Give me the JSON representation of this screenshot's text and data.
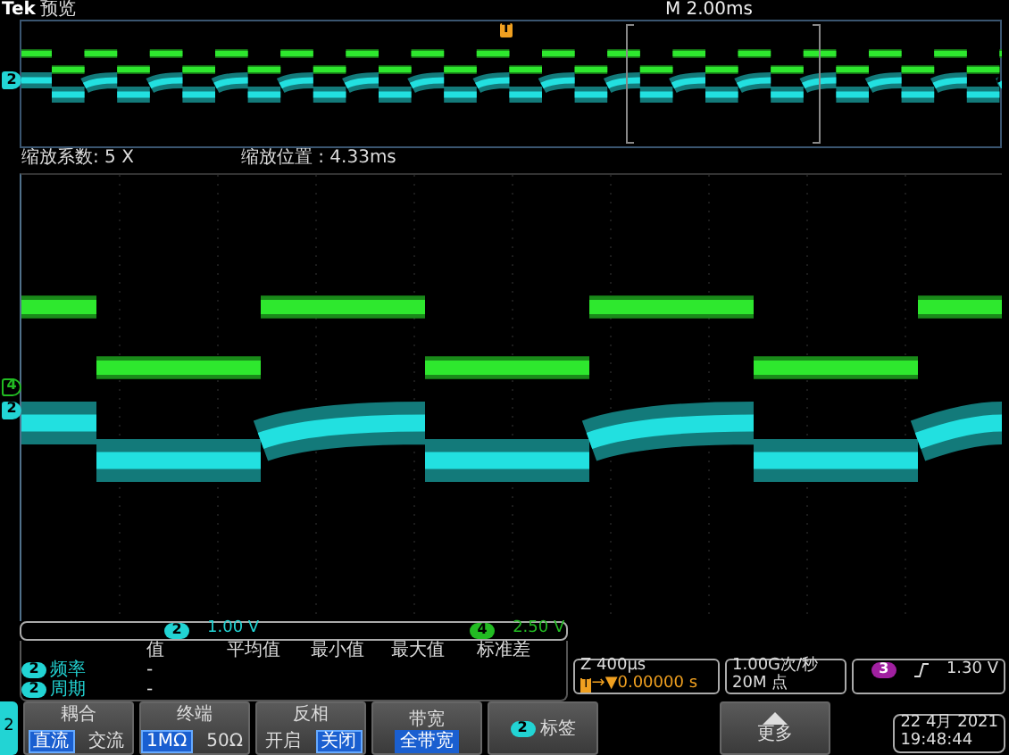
{
  "header": {
    "brand": "Tek",
    "mode": "预览",
    "timebase": "M 2.00ms"
  },
  "overview": {
    "channel": "2",
    "trigger_marker": "T"
  },
  "zoom_info": {
    "factor": "缩放系数: 5 X",
    "position": "缩放位置 : 4.33ms"
  },
  "channel_markers": [
    {
      "label": "4",
      "color": "#22bb22"
    },
    {
      "label": "2",
      "color": "#22d4d4"
    }
  ],
  "scales": [
    {
      "channel": "2",
      "value": "1.00 V",
      "color": "#22d4d4"
    },
    {
      "channel": "4",
      "value": "2.50 V",
      "color": "#22bb22"
    }
  ],
  "measurements": {
    "columns": [
      "值",
      "平均值",
      "最小值",
      "最大值",
      "标准差"
    ],
    "rows": [
      {
        "channel": "2",
        "name": "频率",
        "value": "-"
      },
      {
        "channel": "2",
        "name": "周期",
        "value": "-"
      }
    ]
  },
  "horizontal": {
    "scale": "Z 400µs",
    "marker": "T",
    "delay": "→▼0.00000 s"
  },
  "acquisition": {
    "rate": "1.00G次/秒",
    "length": "20M 点"
  },
  "trigger": {
    "source": "3",
    "color": "#a020a0",
    "level": "1.30 V"
  },
  "side_tab": "2",
  "menu_buttons": [
    {
      "kind": "choice",
      "title": "耦合",
      "options": [
        {
          "label": "直流",
          "selected": true
        },
        {
          "label": "交流",
          "selected": false
        }
      ]
    },
    {
      "kind": "choice",
      "title": "终端",
      "options": [
        {
          "label": "1MΩ",
          "selected": true
        },
        {
          "label": "50Ω",
          "selected": false
        }
      ]
    },
    {
      "kind": "choice",
      "title": "反相",
      "options": [
        {
          "label": "开启",
          "selected": false
        },
        {
          "label": "关闭",
          "selected": true
        }
      ]
    },
    {
      "kind": "value",
      "title": "带宽",
      "value": "全带宽"
    },
    {
      "kind": "label",
      "channel": "2",
      "title": "标签"
    }
  ],
  "more_button": "更多",
  "datetime": {
    "date": "22 4月 2021",
    "time": "19:48:44"
  }
}
